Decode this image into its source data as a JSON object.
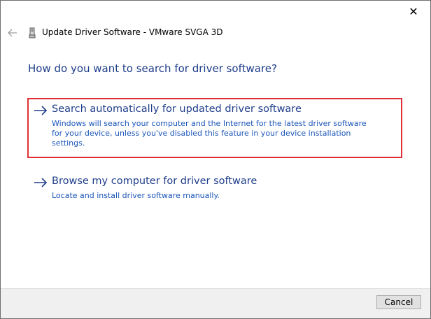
{
  "window": {
    "title": "Update Driver Software - VMware SVGA 3D",
    "close_glyph": "✕"
  },
  "main": {
    "question": "How do you want to search for driver software?",
    "options": [
      {
        "title": "Search automatically for updated driver software",
        "description": "Windows will search your computer and the Internet for the latest driver software for your device, unless you've disabled this feature in your device installation settings.",
        "icon": "arrow-right-icon"
      },
      {
        "title": "Browse my computer for driver software",
        "description": "Locate and install driver software manually.",
        "icon": "arrow-right-icon"
      }
    ]
  },
  "footer": {
    "cancel_label": "Cancel"
  },
  "colors": {
    "accent": "#1f3d8a",
    "link": "#1a55b8",
    "highlight": "#e03035",
    "footer_bg": "#f0f0f0"
  }
}
